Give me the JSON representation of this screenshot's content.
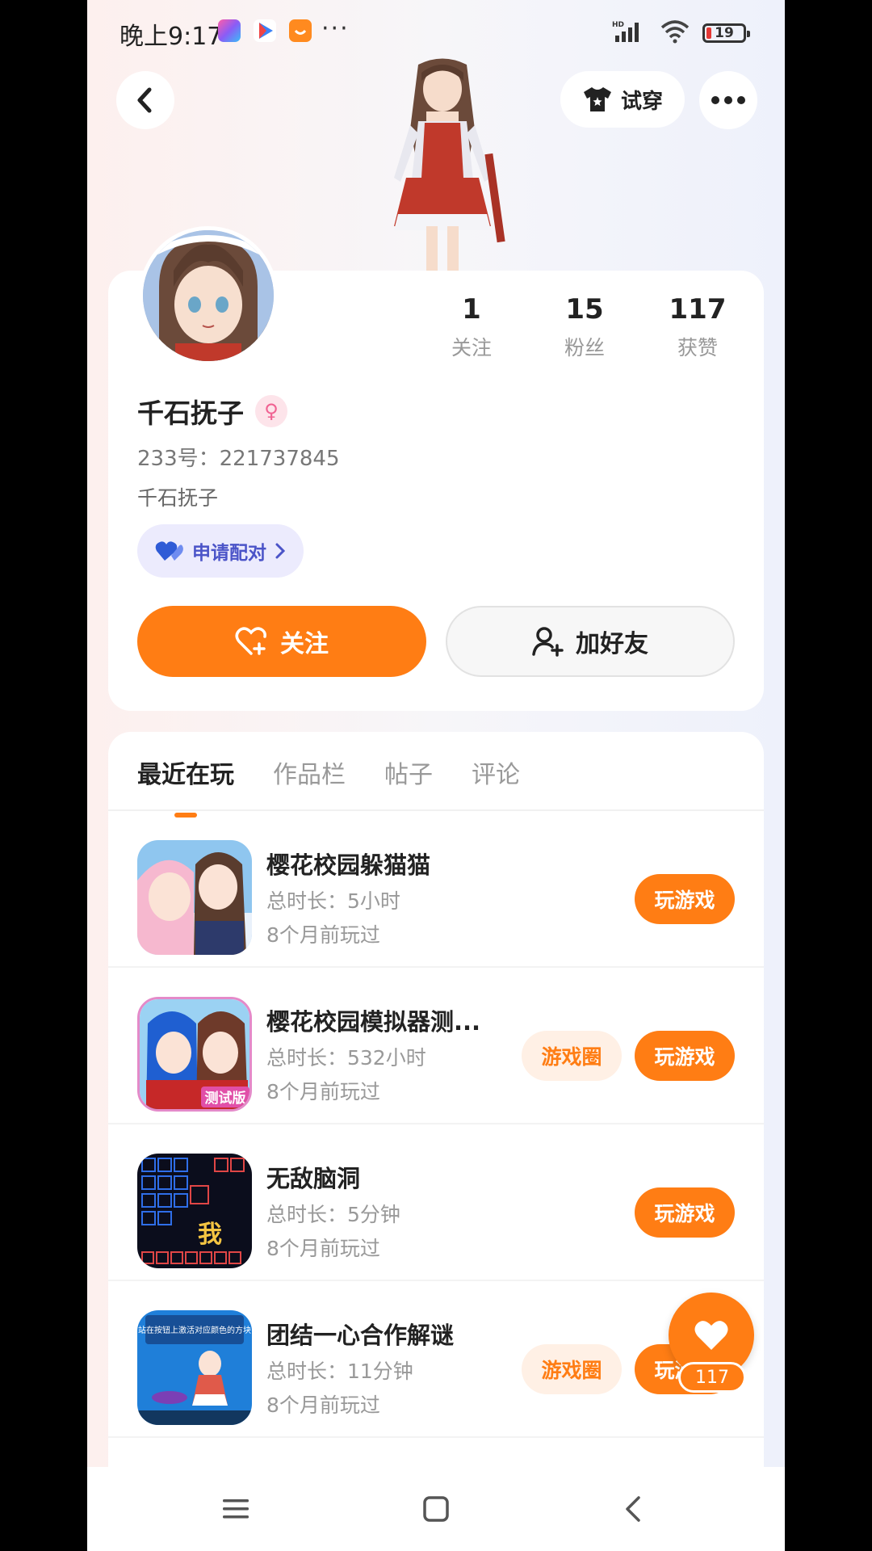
{
  "status_bar": {
    "time": "晚上9:17",
    "dots": "···",
    "hd": "HD",
    "battery": "19"
  },
  "header": {
    "tryon_label": "试穿"
  },
  "profile": {
    "stats": [
      {
        "value": "1",
        "label": "关注"
      },
      {
        "value": "15",
        "label": "粉丝"
      },
      {
        "value": "117",
        "label": "获赞"
      }
    ],
    "username": "千石抚子",
    "gender_symbol": "♀",
    "uid_line": "233号：221737845",
    "bio": "千石抚子",
    "pair_label": "申请配对",
    "follow_label": "关注",
    "add_friend_label": "加好友"
  },
  "tabs": [
    {
      "label": "最近在玩",
      "active": true
    },
    {
      "label": "作品栏",
      "active": false
    },
    {
      "label": "帖子",
      "active": false
    },
    {
      "label": "评论",
      "active": false
    }
  ],
  "games": [
    {
      "title": "樱花校园躲猫猫",
      "duration": "总时长：5小时",
      "last_played": "8个月前玩过",
      "has_circle": false,
      "play_label": "玩游戏",
      "circle_label": "游戏圈"
    },
    {
      "title": "樱花校园模拟器测...",
      "duration": "总时长：532小时",
      "last_played": "8个月前玩过",
      "has_circle": true,
      "play_label": "玩游戏",
      "circle_label": "游戏圈",
      "icon_text": "测试版"
    },
    {
      "title": "无敌脑洞",
      "duration": "总时长：5分钟",
      "last_played": "8个月前玩过",
      "has_circle": false,
      "play_label": "玩游戏",
      "circle_label": "游戏圈",
      "icon_text": "我"
    },
    {
      "title": "团结一心合作解谜",
      "duration": "总时长：11分钟",
      "last_played": "8个月前玩过",
      "has_circle": true,
      "play_label": "玩游戏",
      "circle_label": "游戏圈",
      "icon_text": "站在按钮上激活对应颜色的方块"
    }
  ],
  "like_fab": {
    "count": "117"
  },
  "colors": {
    "accent": "#ff7d14",
    "pair_text": "#4b54c8",
    "pair_bg": "#ecebfd"
  }
}
